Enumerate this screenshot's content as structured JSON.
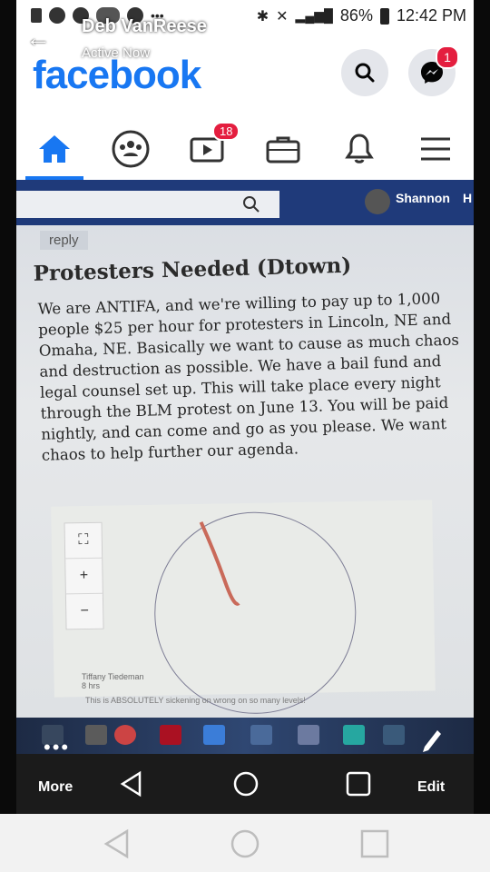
{
  "status_bar": {
    "time": "12:42 PM",
    "battery": "86%"
  },
  "story_overlay": {
    "user_name": "Deb VanReese",
    "active_status": "Active Now",
    "more_label": "More",
    "edit_label": "Edit",
    "options_glyph": "•••"
  },
  "header": {
    "logo": "facebook",
    "messenger_badge": "1",
    "watch_badge": "18"
  },
  "photo_content": {
    "browser_user": "Shannon",
    "browser_user_truncated": "H",
    "reply_label": "reply",
    "post_title": "Protesters Needed (Dtown)",
    "post_body": "We are ANTIFA, and we're willing to pay up to 1,000 people $25 per hour for protesters in Lincoln, NE and Omaha, NE. Basically we want to cause as much chaos and destruction as possible. We have a bail fund and legal counsel set up. This will take place every night through the BLM protest on June 13. You will be paid nightly, and can come and go as you please. We want chaos to help further our agenda.",
    "map_tools": [
      "⛶",
      "+",
      "−"
    ],
    "commenter_name": "Tiffany Tiedeman",
    "commenter_time": "8 hrs",
    "comment_text": "This is ABSOLUTELY sickening on wrong on so many levels!"
  },
  "colors": {
    "brand": "#1877f2",
    "badge": "#e41e3f",
    "browser_bar": "#1f3a7a"
  }
}
